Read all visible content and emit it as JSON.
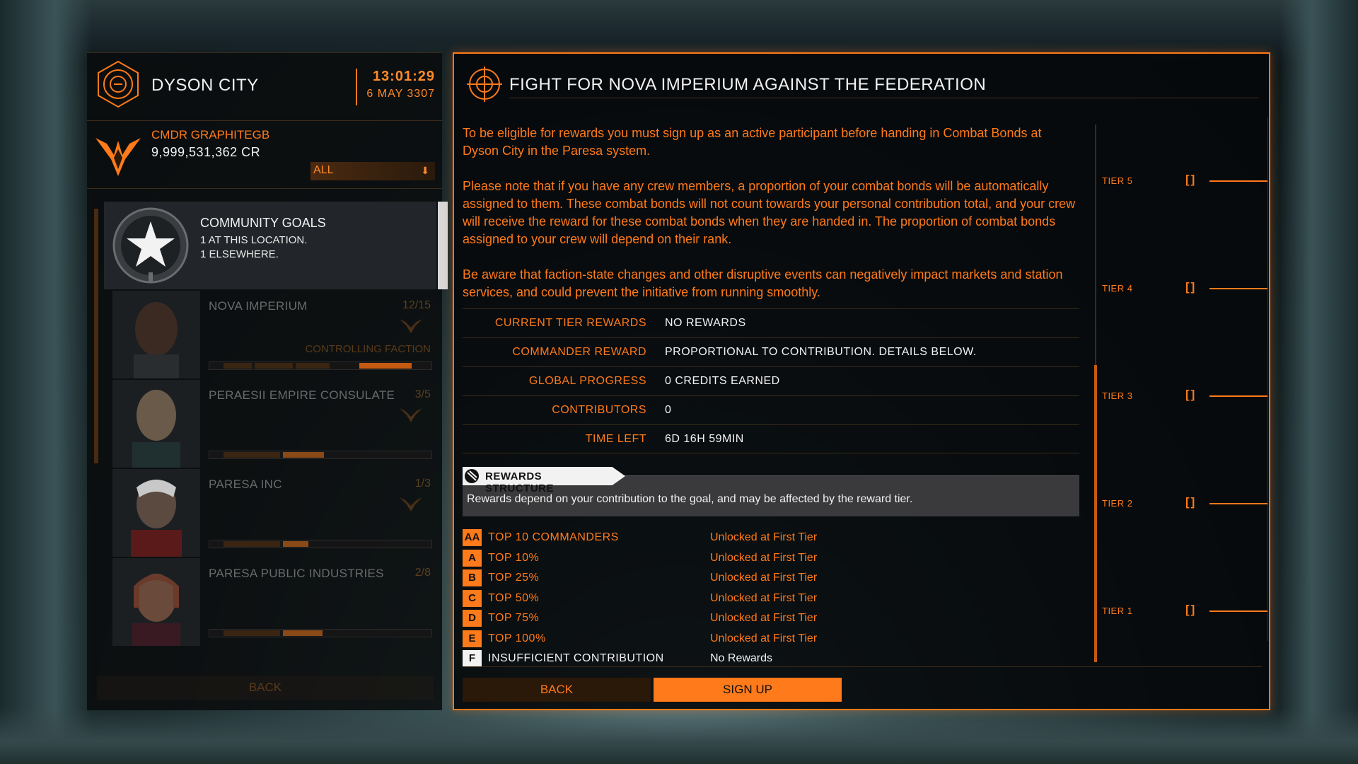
{
  "station": {
    "name": "DYSON CITY",
    "time": "13:01:29",
    "date": "6 MAY 3307"
  },
  "commander": {
    "name": "CMDR GRAPHITEGB",
    "credits": "9,999,531,362 CR",
    "filter": "ALL"
  },
  "community_goals": {
    "title": "COMMUNITY GOALS",
    "at_location": "1 AT THIS LOCATION.",
    "elsewhere": "1 ELSEWHERE."
  },
  "factions": [
    {
      "name": "NOVA IMPERIUM",
      "count": "12/15",
      "tag": "CONTROLLING FACTION",
      "progress": 0.8
    },
    {
      "name": "PERAESII EMPIRE CONSULATE",
      "count": "3/5",
      "tag": "",
      "progress": 0.6
    },
    {
      "name": "PARESA INC",
      "count": "1/3",
      "tag": "",
      "progress": 0.33
    },
    {
      "name": "PARESA PUBLIC INDUSTRIES",
      "count": "2/8",
      "tag": "",
      "progress": 0.6
    }
  ],
  "left_back_label": "BACK",
  "goal": {
    "title": "FIGHT FOR NOVA IMPERIUM AGAINST THE FEDERATION",
    "desc1": "To be eligible for rewards you must sign up as an active participant before handing in Combat Bonds at Dyson City in the Paresa system.",
    "desc2": "Please note that if you have any crew members, a proportion of your combat bonds will be automatically assigned to them. These combat bonds will not count towards your personal contribution total, and your crew will receive the reward for these combat bonds when they are handed in. The proportion of combat bonds assigned to your crew will depend on their rank.",
    "desc3": "Be aware that faction-state changes and other disruptive events can negatively impact markets and station services, and could prevent the initiative from running smoothly."
  },
  "info": [
    {
      "label": "CURRENT TIER REWARDS",
      "value": "NO REWARDS"
    },
    {
      "label": "COMMANDER REWARD",
      "value": "PROPORTIONAL TO CONTRIBUTION. DETAILS BELOW."
    },
    {
      "label": "GLOBAL PROGRESS",
      "value": "0 CREDITS EARNED"
    },
    {
      "label": "CONTRIBUTORS",
      "value": "0"
    },
    {
      "label": "TIME LEFT",
      "value": "6D 16H 59MIN"
    }
  ],
  "rewards": {
    "header": "REWARDS STRUCTURE",
    "description": "Rewards depend on your contribution to the goal, and may be affected by the reward tier.",
    "grades": [
      {
        "badge": "AA",
        "name": "TOP 10 COMMANDERS",
        "status": "Unlocked at First Tier"
      },
      {
        "badge": "A",
        "name": "TOP 10%",
        "status": "Unlocked at First Tier"
      },
      {
        "badge": "B",
        "name": "TOP 25%",
        "status": "Unlocked at First Tier"
      },
      {
        "badge": "C",
        "name": "TOP 50%",
        "status": "Unlocked at First Tier"
      },
      {
        "badge": "D",
        "name": "TOP 75%",
        "status": "Unlocked at First Tier"
      },
      {
        "badge": "E",
        "name": "TOP 100%",
        "status": "Unlocked at First Tier"
      },
      {
        "badge": "F",
        "name": "INSUFFICIENT CONTRIBUTION",
        "status": "No Rewards"
      }
    ]
  },
  "tiers": [
    {
      "label": "TIER 5",
      "bracket": "[]"
    },
    {
      "label": "TIER 4",
      "bracket": "[]"
    },
    {
      "label": "TIER 3",
      "bracket": "[]"
    },
    {
      "label": "TIER 2",
      "bracket": "[]"
    },
    {
      "label": "TIER 1",
      "bracket": "[]"
    }
  ],
  "buttons": {
    "back": "BACK",
    "sign_up": "SIGN UP"
  },
  "colors": {
    "accent": "#ff7a1a",
    "text_light": "#f2f2f2",
    "panel_bg": "#06080a"
  }
}
